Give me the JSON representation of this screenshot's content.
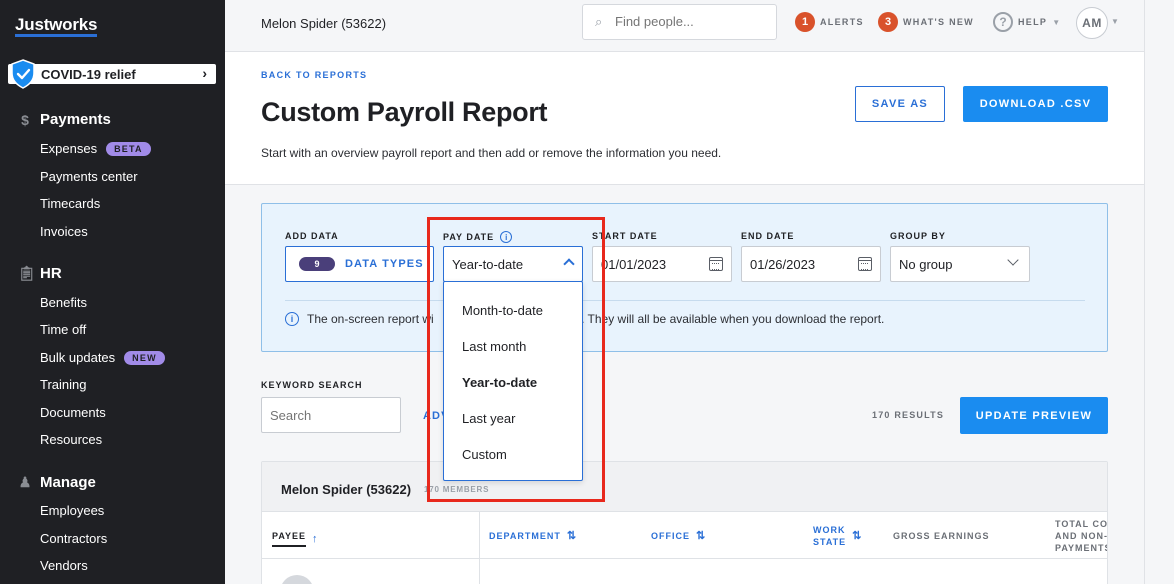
{
  "sidebar": {
    "logo": "Justworks",
    "covid_label": "COVID-19 relief",
    "payments": {
      "title": "Payments",
      "items": [
        {
          "label": "Expenses",
          "badge": "BETA"
        },
        {
          "label": "Payments center"
        },
        {
          "label": "Timecards"
        },
        {
          "label": "Invoices"
        }
      ]
    },
    "hr": {
      "title": "HR",
      "items": [
        {
          "label": "Benefits"
        },
        {
          "label": "Time off"
        },
        {
          "label": "Bulk updates",
          "badge": "NEW"
        },
        {
          "label": "Training"
        },
        {
          "label": "Documents"
        },
        {
          "label": "Resources"
        }
      ]
    },
    "manage": {
      "title": "Manage",
      "items": [
        {
          "label": "Employees"
        },
        {
          "label": "Contractors"
        },
        {
          "label": "Vendors"
        }
      ]
    }
  },
  "topbar": {
    "company": "Melon Spider (53622)",
    "search_placeholder": "Find people...",
    "alerts_count": "1",
    "alerts_label": "ALERTS",
    "whats_new_count": "3",
    "whats_new_label": "WHAT'S NEW",
    "help_label": "HELP",
    "avatar_initials": "AM"
  },
  "header": {
    "back_link": "BACK TO REPORTS",
    "title": "Custom Payroll Report",
    "subtitle": "Start with an overview payroll report and then add or remove the information you need.",
    "save_as": "SAVE AS",
    "download": "DOWNLOAD .CSV"
  },
  "filters": {
    "add_data_label": "ADD DATA",
    "data_types_count": "9",
    "data_types_label": "DATA TYPES",
    "pay_date_label": "PAY DATE",
    "pay_date_value": "Year-to-date",
    "start_date_label": "START DATE",
    "start_date_value": "01/01/2023",
    "end_date_label": "END DATE",
    "end_date_value": "01/26/2023",
    "group_by_label": "GROUP BY",
    "group_by_value": "No group",
    "notice_start": "The on-screen report wi",
    "notice_end": "nns. They will all be available when you download the report."
  },
  "search": {
    "keyword_label": "KEYWORD SEARCH",
    "placeholder": "Search",
    "advanced_partial": "ADV",
    "results": "170 RESULTS",
    "update_preview": "UPDATE PREVIEW"
  },
  "table": {
    "group_name": "Melon Spider (53622)",
    "members": "170 MEMBERS",
    "columns": {
      "payee": "PAYEE",
      "department": "DEPARTMENT",
      "office": "OFFICE",
      "work_state_1": "WORK",
      "work_state_2": "STATE",
      "gross_earnings": "GROSS EARNINGS",
      "total_1": "TOTAL CO",
      "total_2": "AND NON-",
      "total_3": "PAYMENTS"
    }
  },
  "pay_date_dropdown": {
    "options": [
      "Month-to-date",
      "Last month",
      "Year-to-date",
      "Last year",
      "Custom"
    ],
    "selected": "Year-to-date"
  },
  "colors": {
    "accent": "#1a8cf0",
    "link": "#2a6fd6",
    "sidebar_bg": "#1f2024",
    "highlight": "#e8281c",
    "alert_badge": "#d9522b"
  }
}
